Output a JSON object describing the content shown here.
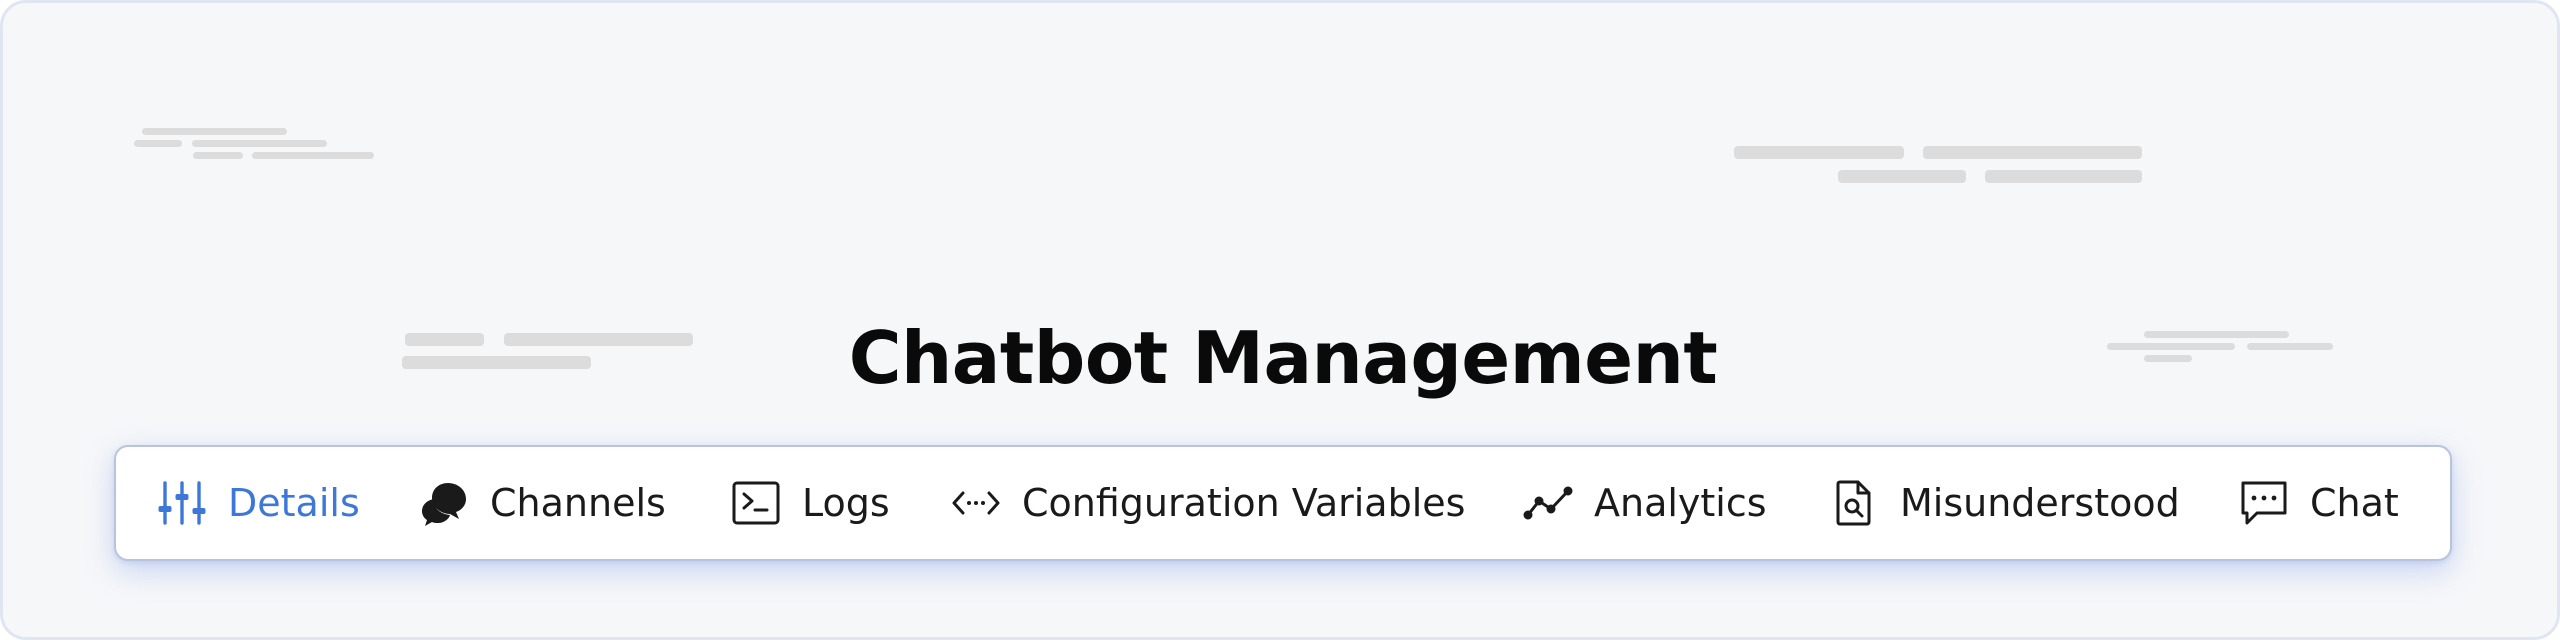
{
  "page": {
    "title": "Chatbot Management"
  },
  "tabs": [
    {
      "id": "details",
      "label": "Details",
      "icon": "sliders-icon",
      "active": true
    },
    {
      "id": "channels",
      "label": "Channels",
      "icon": "chat-bubbles-icon",
      "active": false
    },
    {
      "id": "logs",
      "label": "Logs",
      "icon": "terminal-icon",
      "active": false
    },
    {
      "id": "config-vars",
      "label": "Configuration Variables",
      "icon": "code-dots-icon",
      "active": false
    },
    {
      "id": "analytics",
      "label": "Analytics",
      "icon": "line-chart-icon",
      "active": false
    },
    {
      "id": "misunderstood",
      "label": "Misunderstood",
      "icon": "document-search-icon",
      "active": false
    },
    {
      "id": "chat",
      "label": "Chat",
      "icon": "message-dots-icon",
      "active": false
    }
  ],
  "colors": {
    "accent": "#3d78d8",
    "text": "#1a1a1a",
    "background": "#f6f7f9",
    "placeholder": "#dcdcdc"
  }
}
